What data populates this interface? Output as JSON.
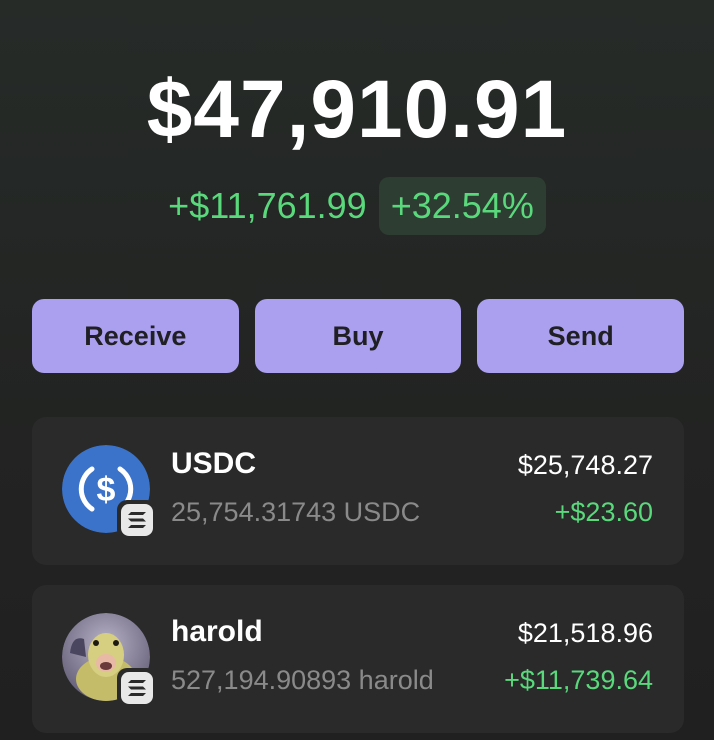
{
  "balance": {
    "total": "$47,910.91",
    "change_amount": "+$11,761.99",
    "change_percent": "+32.54%"
  },
  "actions": {
    "receive_label": "Receive",
    "buy_label": "Buy",
    "send_label": "Send"
  },
  "tokens": [
    {
      "name": "USDC",
      "amount": "25,754.31743 USDC",
      "value": "$25,748.27",
      "change": "+$23.60",
      "icon": "usdc-icon",
      "chain_icon": "solana-icon"
    },
    {
      "name": "harold",
      "amount": "527,194.90893 harold",
      "value": "$21,518.96",
      "change": "+$11,739.64",
      "icon": "harold-duck-icon",
      "chain_icon": "solana-icon"
    }
  ],
  "colors": {
    "accent": "#ab9ff0",
    "positive": "#5ad87c",
    "card": "#2a2a2a",
    "usdc_blue": "#2775ca"
  }
}
